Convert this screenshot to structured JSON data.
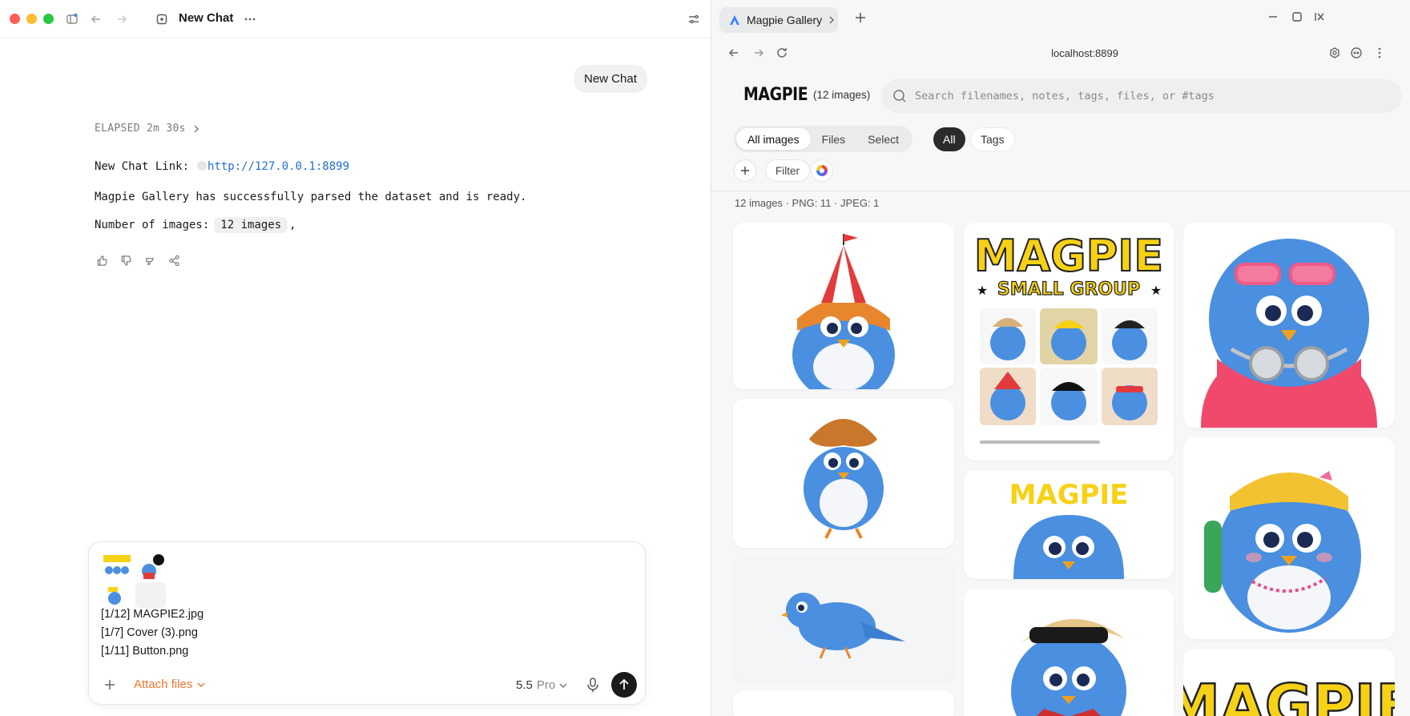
{
  "chat": {
    "window_title": "New Chat",
    "user_message": "New Chat",
    "elapsed": "ELAPSED 2m 30s",
    "link_label": "New Chat Link:",
    "link_url": "http://127.0.0.1:8899",
    "status_line": "Magpie Gallery has successfully parsed the dataset and is ready.",
    "count_label": "Number of images:",
    "count_value": "12 images",
    "count_suffix": ","
  },
  "composer": {
    "attachments": [
      "[1/12] MAGPIE2.jpg",
      "[1/7] Cover (3).png",
      "[1/11] Button.png"
    ],
    "attach_label": "Attach files",
    "model_name": "5.5",
    "model_tier": "Pro"
  },
  "browser": {
    "tab_title": "Magpie Gallery",
    "url": "localhost:8899"
  },
  "gallery": {
    "logo": "MAGPIE",
    "count": "(12 images)",
    "search_placeholder": "Search filenames, notes, tags, files, or #tags",
    "segments": [
      "All images",
      "Files",
      "Select"
    ],
    "pill_all": "All",
    "pill_tags": "Tags",
    "filter_label": "Filter",
    "summary": "12 images · PNG: 11 · JPEG: 1",
    "poster_title": "MAGPIE",
    "poster_subtitle": "SMALL GROUP",
    "banner_title": "MAGPIE",
    "bottom_title": "MAGPIE"
  },
  "colors": {
    "accent": "#e8772e",
    "link": "#1f6ed4",
    "bird_blue": "#4a8fe0",
    "poster_yellow": "#f7d115"
  }
}
